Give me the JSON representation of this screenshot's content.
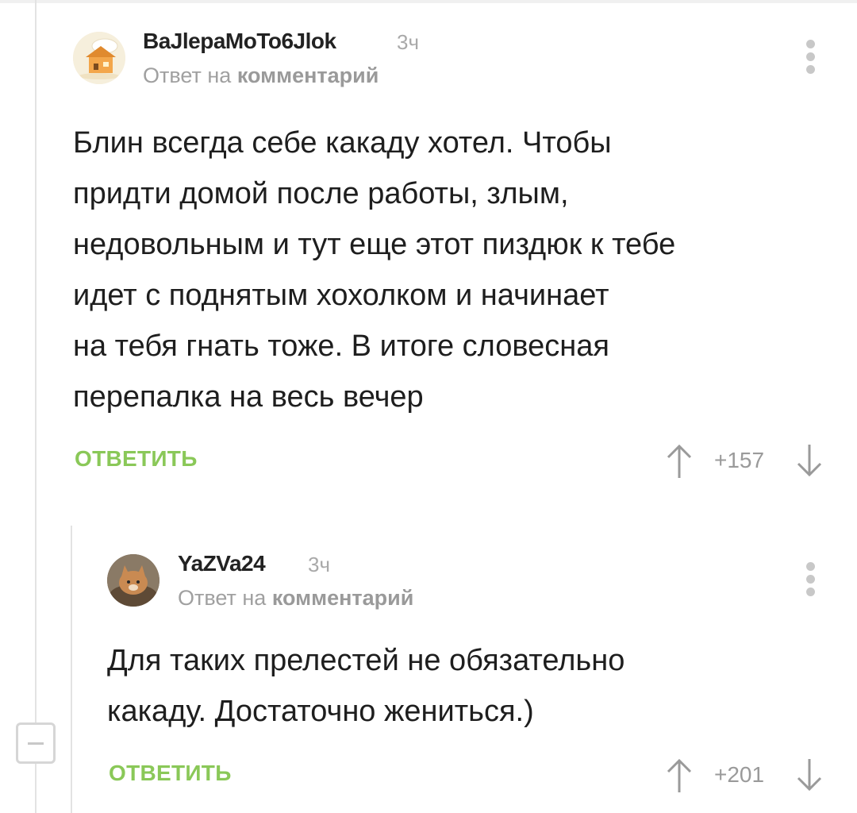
{
  "comments": [
    {
      "username": "BaJlepaMoTo6Jlok",
      "time": "3ч",
      "reply_prefix": "Ответ на",
      "reply_target": "комментарий",
      "lines": [
        "Блин всегда себе какаду хотел. Чтобы",
        "придти домой после работы, злым,",
        "недовольным и тут еще этот пиздюк к тебе",
        "идет с поднятым хохолком и начинает",
        "на тебя гнать тоже. В итоге словесная",
        "перепалка на весь вечер"
      ],
      "reply_label": "ОТВЕТИТЬ",
      "score": "+157"
    },
    {
      "username": "YaZVa24",
      "time": "3ч",
      "reply_prefix": "Ответ на",
      "reply_target": "комментарий",
      "lines": [
        "Для таких прелестей не обязательно",
        "какаду. Достаточно жениться.)"
      ],
      "reply_label": "ОТВЕТИТЬ",
      "score": "+201"
    }
  ],
  "icons": {
    "upvote": "arrow-up-icon",
    "downvote": "arrow-down-icon",
    "more": "more-vertical-icon",
    "collapse": "minus-icon"
  },
  "colors": {
    "accent_green": "#8ac858",
    "muted_text": "#a0a0a0"
  }
}
